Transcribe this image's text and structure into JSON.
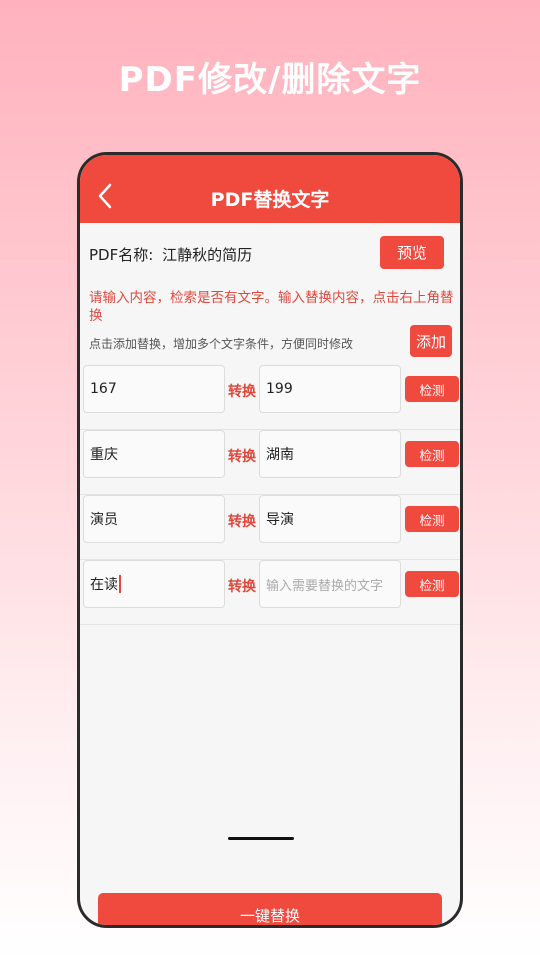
{
  "promo": {
    "title": "PDF修改/删除文字"
  },
  "app_bar": {
    "title": "PDF替换文字",
    "back_icon": "chevron-left-icon"
  },
  "pdf": {
    "label": "PDF名称:",
    "name": "江静秋的简历",
    "preview_label": "预览"
  },
  "instruction": "请输入内容，检索是否有文字。输入替换内容，点击右上角替换",
  "hint": "点击添加替换，增加多个文字条件，方便同时修改",
  "add_label": "添加",
  "rules": [
    {
      "source": "167",
      "convert": "转换",
      "target": "199",
      "target_placeholder": "",
      "detect": "检测"
    },
    {
      "source": "重庆",
      "convert": "转换",
      "target": "湖南",
      "target_placeholder": "",
      "detect": "检测"
    },
    {
      "source": "演员",
      "convert": "转换",
      "target": "导演",
      "target_placeholder": "",
      "detect": "检测"
    },
    {
      "source": "在读",
      "convert": "转换",
      "target": "",
      "target_placeholder": "输入需要替换的文字",
      "detect": "检测"
    }
  ],
  "replace_all_label": "一键替换",
  "colors": {
    "accent": "#f04a3e",
    "accent_text": "#e0483c"
  }
}
